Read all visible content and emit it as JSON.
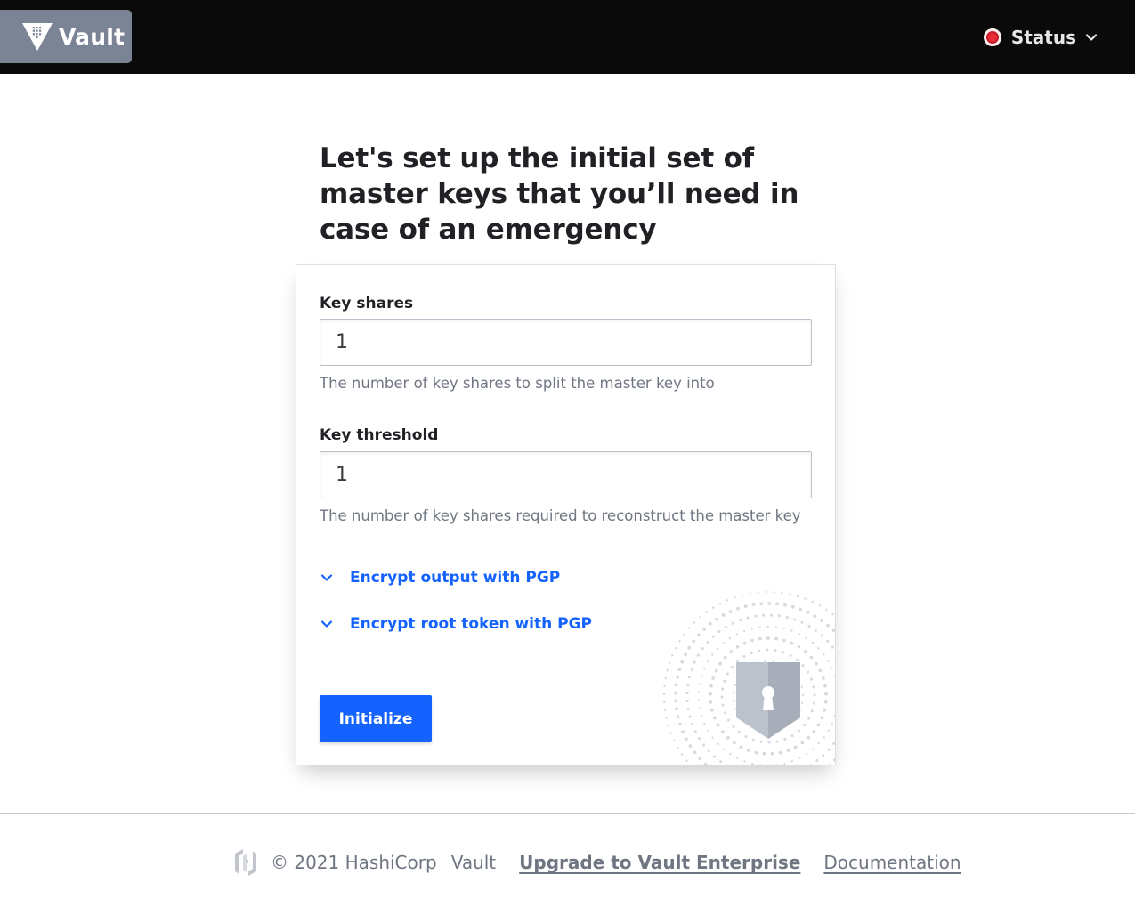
{
  "header": {
    "brand_label": "Vault",
    "status_label": "Status",
    "status_color": "#eb2b36"
  },
  "main": {
    "heading": "Let's set up the initial set of master keys that you’ll need in case of an emergency",
    "key_shares": {
      "label": "Key shares",
      "value": "1",
      "help": "The number of key shares to split the master key into"
    },
    "key_threshold": {
      "label": "Key threshold",
      "value": "1",
      "help": "The number of key shares required to reconstruct the master key"
    },
    "toggles": [
      {
        "label": "Encrypt output with PGP",
        "icon": "chevron-down-icon"
      },
      {
        "label": "Encrypt root token with PGP",
        "icon": "chevron-down-icon"
      }
    ],
    "initialize_label": "Initialize",
    "accent_color": "#1563ff"
  },
  "footer": {
    "copyright": "© 2021 HashiCorp",
    "product": "Vault",
    "upgrade_link": "Upgrade to Vault Enterprise",
    "docs_link": "Documentation"
  }
}
